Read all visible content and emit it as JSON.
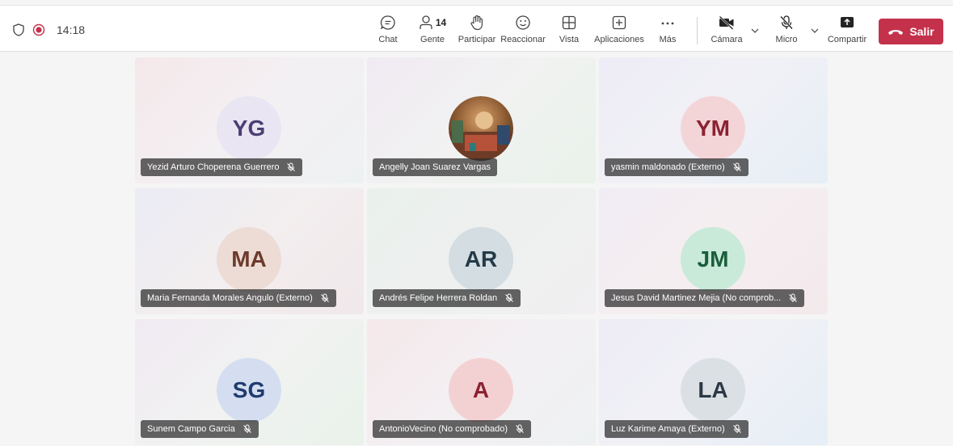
{
  "status": {
    "timer": "14:18"
  },
  "toolbar": {
    "chat_label": "Chat",
    "people_label": "Gente",
    "people_count": "14",
    "raise_label": "Participar",
    "react_label": "Reaccionar",
    "view_label": "Vista",
    "apps_label": "Aplicaciones",
    "more_label": "Más",
    "camera_label": "Cámara",
    "mic_label": "Micro",
    "share_label": "Compartir",
    "leave_label": "Salir"
  },
  "colors": {
    "leave": "#c4314b",
    "tag_bg": "#292929"
  },
  "participants": [
    {
      "initials": "YG",
      "name": "Yezid Arturo Choperena Guerrero",
      "muted": true,
      "avatar_bg": "#e9e5f2",
      "avatar_fg": "#4b3f72"
    },
    {
      "initials": "",
      "name": "Angelly Joan Suarez Vargas",
      "muted": false,
      "avatar_bg": "#8a5a33",
      "avatar_fg": "#ffffff"
    },
    {
      "initials": "YM",
      "name": "yasmin maldonado (Externo)",
      "muted": true,
      "avatar_bg": "#f3d5d8",
      "avatar_fg": "#8b2232"
    },
    {
      "initials": "MA",
      "name": "Maria Fernanda Morales Angulo (Externo)",
      "muted": true,
      "avatar_bg": "#ecdcd5",
      "avatar_fg": "#6b3a2c"
    },
    {
      "initials": "AR",
      "name": "Andrés Felipe Herrera Roldan",
      "muted": true,
      "avatar_bg": "#d3dde2",
      "avatar_fg": "#243a48"
    },
    {
      "initials": "JM",
      "name": "Jesus David Martinez Mejia (No comprob...",
      "muted": true,
      "avatar_bg": "#c9ead9",
      "avatar_fg": "#1b5e3c"
    },
    {
      "initials": "SG",
      "name": "Sunem Campo Garcia",
      "muted": true,
      "avatar_bg": "#d4def0",
      "avatar_fg": "#1f3b70"
    },
    {
      "initials": "A",
      "name": "AntonioVecino (No comprobado)",
      "muted": true,
      "avatar_bg": "#f3d1d3",
      "avatar_fg": "#8b2232"
    },
    {
      "initials": "LA",
      "name": "Luz Karime Amaya (Externo)",
      "muted": true,
      "avatar_bg": "#dbe0e5",
      "avatar_fg": "#2c3944"
    }
  ]
}
